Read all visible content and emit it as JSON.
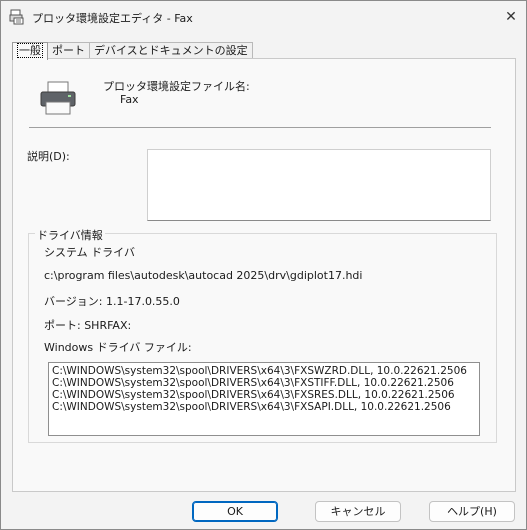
{
  "window": {
    "title": "プロッタ環境設定エディタ - Fax"
  },
  "tabs": [
    {
      "label": "一般",
      "active": true
    },
    {
      "label": "ポート",
      "active": false
    },
    {
      "label": "デバイスとドキュメントの設定",
      "active": false
    }
  ],
  "general": {
    "config_label": "プロッタ環境設定ファイル名:",
    "config_value": "Fax",
    "description_label": "説明(D):",
    "description_value": ""
  },
  "driver_info": {
    "group_title": "ドライバ情報",
    "driver_type": "システム ドライバ",
    "driver_path": "c:\\program files\\autodesk\\autocad 2025\\drv\\gdiplot17.hdi",
    "version": "バージョン: 1.1-17.0.55.0",
    "port": "ポート: SHRFAX:",
    "files_label": "Windows ドライバ ファイル:",
    "files": [
      "C:\\WINDOWS\\system32\\spool\\DRIVERS\\x64\\3\\FXSWZRD.DLL, 10.0.22621.2506",
      "C:\\WINDOWS\\system32\\spool\\DRIVERS\\x64\\3\\FXSTIFF.DLL, 10.0.22621.2506",
      "C:\\WINDOWS\\system32\\spool\\DRIVERS\\x64\\3\\FXSRES.DLL, 10.0.22621.2506",
      "C:\\WINDOWS\\system32\\spool\\DRIVERS\\x64\\3\\FXSAPI.DLL, 10.0.22621.2506"
    ]
  },
  "buttons": {
    "ok": "OK",
    "cancel": "キャンセル",
    "help": "ヘルプ(H)"
  }
}
